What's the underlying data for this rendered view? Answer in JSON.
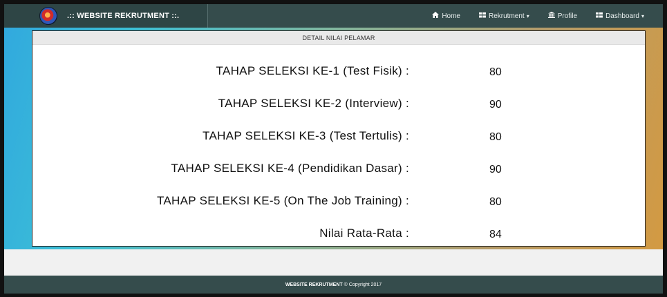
{
  "navbar": {
    "brand": ".:: WEBSITE REKRUTMENT ::.",
    "items": [
      {
        "icon": "home-icon",
        "glyph": "⌂",
        "label": "Home",
        "dropdown": false
      },
      {
        "icon": "list-icon",
        "glyph": "▦",
        "label": "Rekrutment",
        "dropdown": true
      },
      {
        "icon": "bank-icon",
        "glyph": "⌂",
        "label": "Profile",
        "dropdown": false
      },
      {
        "icon": "grid-icon",
        "glyph": "▦",
        "label": "Dashboard",
        "dropdown": true
      }
    ]
  },
  "panel": {
    "header": "DETAIL NILAI PELAMAR",
    "rows": [
      {
        "label": "TAHAP SELEKSI KE-1 (Test Fisik) :",
        "value": "80"
      },
      {
        "label": "TAHAP SELEKSI KE-2 (Interview) :",
        "value": "90"
      },
      {
        "label": "TAHAP SELEKSI KE-3 (Test Tertulis) :",
        "value": "80"
      },
      {
        "label": "TAHAP SELEKSI KE-4 (Pendidikan Dasar) :",
        "value": "90"
      },
      {
        "label": "TAHAP SELEKSI KE-5 (On The Job Training) :",
        "value": "80"
      },
      {
        "label": "Nilai Rata-Rata :",
        "value": "84"
      }
    ]
  },
  "footer": {
    "brand": "WEBSITE REKRUTMENT",
    "copyright": "© Copyright 2017"
  },
  "colors": {
    "navbar": "#354c4c",
    "gradient_start": "#31a9de",
    "gradient_end": "#d39a42"
  }
}
